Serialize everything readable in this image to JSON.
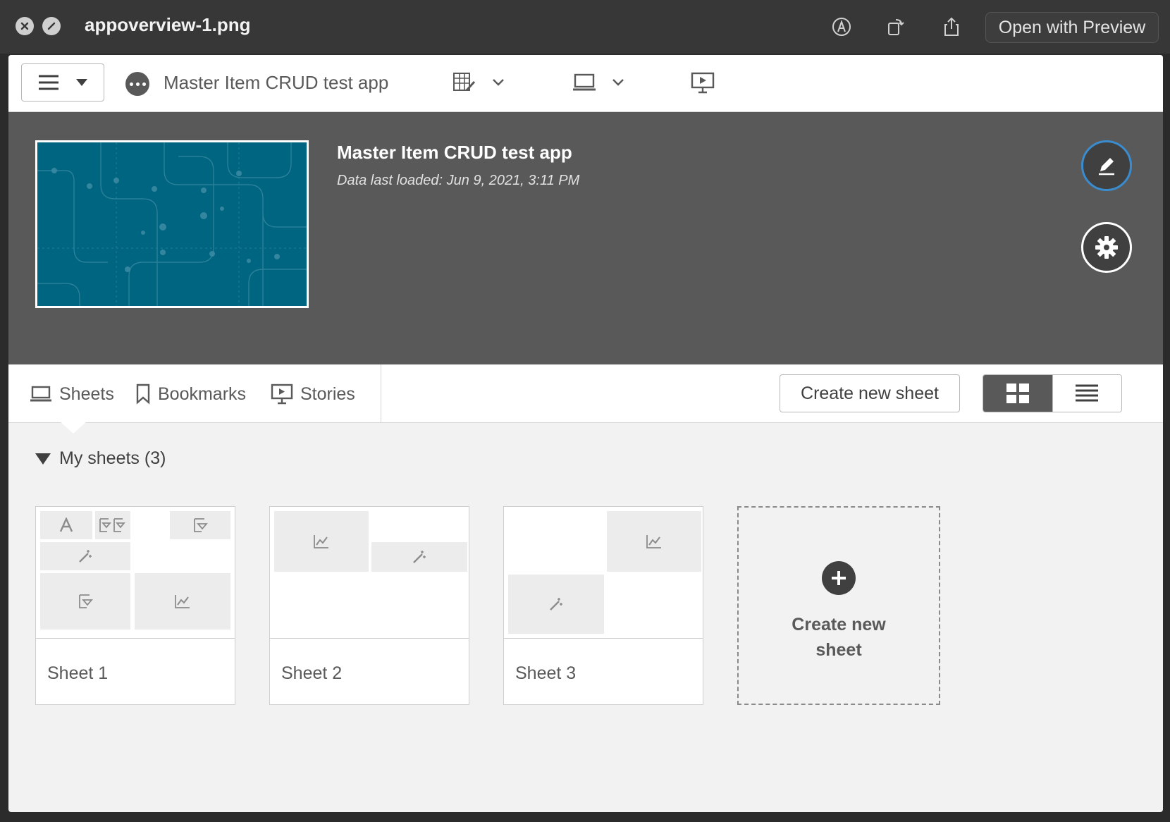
{
  "titlebar": {
    "filename": "appoverview-1.png",
    "open_with_preview": "Open with Preview"
  },
  "toolbar": {
    "app_name": "Master Item CRUD test app"
  },
  "hero": {
    "title": "Master Item CRUD test app",
    "subtitle": "Data last loaded: Jun 9, 2021, 3:11 PM"
  },
  "tabs": [
    {
      "label": "Sheets",
      "icon": "sheets-icon"
    },
    {
      "label": "Bookmarks",
      "icon": "bookmark-icon"
    },
    {
      "label": "Stories",
      "icon": "stories-icon"
    }
  ],
  "actions": {
    "create_new_sheet": "Create new sheet"
  },
  "section": {
    "title": "My sheets (3)"
  },
  "sheets": [
    {
      "label": "Sheet 1"
    },
    {
      "label": "Sheet 2"
    },
    {
      "label": "Sheet 3"
    }
  ],
  "new_card": {
    "label": "Create new sheet"
  },
  "colors": {
    "hero_bg": "#595959",
    "thumbnail_bg": "#006580",
    "edit_ring": "#3a8ccf"
  }
}
